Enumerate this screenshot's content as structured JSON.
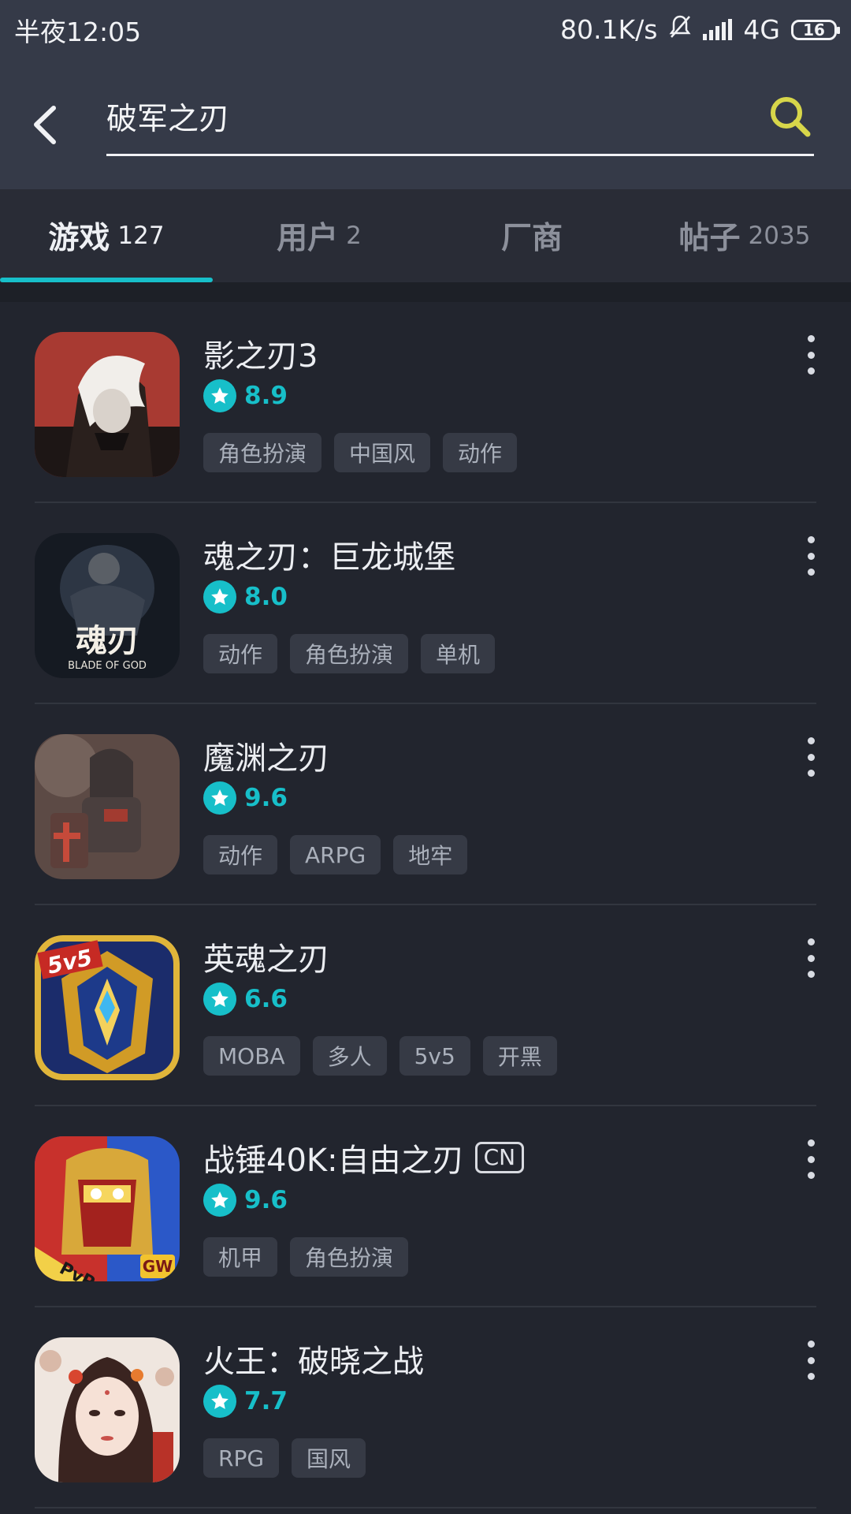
{
  "status_bar": {
    "time": "半夜12:05",
    "network_speed": "80.1K/s",
    "network_type": "4G",
    "battery": "16"
  },
  "search": {
    "query": "破军之刃"
  },
  "tabs": [
    {
      "label": "游戏",
      "count": "127",
      "active": true
    },
    {
      "label": "用户",
      "count": "2",
      "active": false
    },
    {
      "label": "厂商",
      "count": "",
      "active": false
    },
    {
      "label": "帖子",
      "count": "2035",
      "active": false
    }
  ],
  "games": [
    {
      "title": "影之刃3",
      "badge": "",
      "rating": "8.9",
      "tags": [
        "角色扮演",
        "中国风",
        "动作"
      ],
      "icon": "shadow-blade-icon"
    },
    {
      "title": "魂之刃：巨龙城堡",
      "badge": "",
      "rating": "8.0",
      "tags": [
        "动作",
        "角色扮演",
        "单机"
      ],
      "icon": "blade-of-god-icon",
      "icon_text": "BLADE OF GOD"
    },
    {
      "title": "魔渊之刃",
      "badge": "",
      "rating": "9.6",
      "tags": [
        "动作",
        "ARPG",
        "地牢"
      ],
      "icon": "armored-knight-icon"
    },
    {
      "title": "英魂之刃",
      "badge": "",
      "rating": "6.6",
      "tags": [
        "MOBA",
        "多人",
        "5v5",
        "开黑"
      ],
      "icon": "golden-shield-icon",
      "icon_text": "5v5"
    },
    {
      "title": "战锤40K:自由之刃",
      "badge": "CN",
      "rating": "9.6",
      "tags": [
        "机甲",
        "角色扮演"
      ],
      "icon": "space-marine-helmet-icon",
      "icon_text": "PvP",
      "icon_text2": "GW"
    },
    {
      "title": "火王：破晓之战",
      "badge": "",
      "rating": "7.7",
      "tags": [
        "RPG",
        "国风"
      ],
      "icon": "heroine-portrait-icon"
    }
  ],
  "colors": {
    "accent": "#17bfc9",
    "search_icon": "#d7d64a",
    "background": "#22252e",
    "header": "#353a48"
  }
}
